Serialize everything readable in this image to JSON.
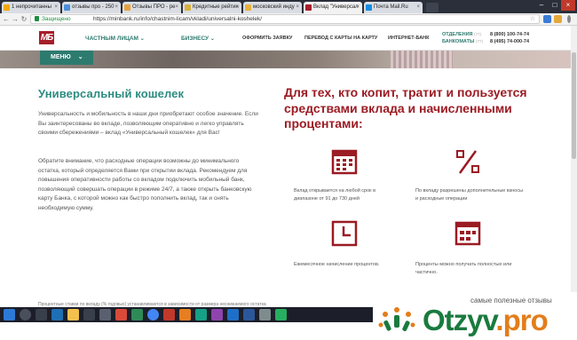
{
  "browser": {
    "tabs": [
      {
        "label": "1 непрочитанны",
        "favicon_color": "#f2a900"
      },
      {
        "label": "отзывы про - 250",
        "favicon_color": "#4a90d9"
      },
      {
        "label": "Отзывы ПРО - ре",
        "favicon_color": "#e8a23a"
      },
      {
        "label": "Кредитные рейтин",
        "favicon_color": "#d9b13a"
      },
      {
        "label": "московский инду",
        "favicon_color": "#e8b23a"
      },
      {
        "label": "Вклад \"Универсал",
        "favicon_color": "#a61e2a"
      },
      {
        "label": "Почта Mail.Ru",
        "favicon_color": "#168de2"
      }
    ],
    "active_tab_index": 5,
    "security_label": "Защищено",
    "url": "https://minbank.ru/info/chastnim-licam/vkladi/universalni-koshelek/"
  },
  "site": {
    "logo_text": "МБ",
    "nav": {
      "private": "ЧАСТНЫМ ЛИЦАМ",
      "business": "БИЗНЕСУ",
      "links": [
        "ОФОРМИТЬ ЗАЯВКУ",
        "ПЕРЕВОД С КАРТЫ НА КАРТУ",
        "ИНТЕРНЕТ-БАНК"
      ]
    },
    "contacts": [
      {
        "label": "ОТДЕЛЕНИЯ",
        "hours": "(??)",
        "phone": "8 (800) 100-74-74"
      },
      {
        "label": "БАНКОМАТЫ",
        "hours": "(??)",
        "phone": "8 (495) 74-000-74"
      }
    ],
    "menu_button": "МЕНЮ"
  },
  "content": {
    "title": "Универсальный кошелек",
    "paragraph1": "Универсальность и мобильность в наши дни приобретают особое значение. Если Вы заинтересованы во вкладе, позволяющим оперативно и легко управлять своими сбережениями – вклад «Универсальный кошелек» для Вас!",
    "paragraph2": "Обратите внимание, что расходные операции возможны до минимального остатка, который определяется Вами при открытии вклада. Рекомендуем для повышения оперативности работы со вкладом подключить мобильный банк, позволяющий совершать операции в режиме 24/7, а также открыть банковскую карту Банка, с которой можно как быстро пополнить вклад, так и снять необходимую сумму.",
    "headline": "Для тех, кто копит, тратит и пользуется средствами вклада и начисленными процентами:",
    "features": [
      {
        "icon": "calendar-icon",
        "text": "Вклад открывается на любой срок в диапазоне от 91 до 730 дней"
      },
      {
        "icon": "percent-icon",
        "text": "По вкладу разрешены дополнительные взносы и расходные операции"
      },
      {
        "icon": "clock-icon",
        "text": "Ежемесячное начисление процентов."
      },
      {
        "icon": "browser-window-icon",
        "text": "Проценты можно получать полностью или частично."
      }
    ],
    "footnote": "Процентные ставки по вкладу (% годовых) устанавливаются в зависимости от размера неснижаемого остатка"
  },
  "watermark": {
    "slogan": "самые полезные отзывы",
    "brand_main": "Otzyv",
    "brand_suffix": ".pro"
  },
  "colors": {
    "accent_teal": "#2d7a6f",
    "brand_red": "#a61e2a",
    "headline_red": "#9b1b23",
    "icon_red": "#9b1b23"
  }
}
